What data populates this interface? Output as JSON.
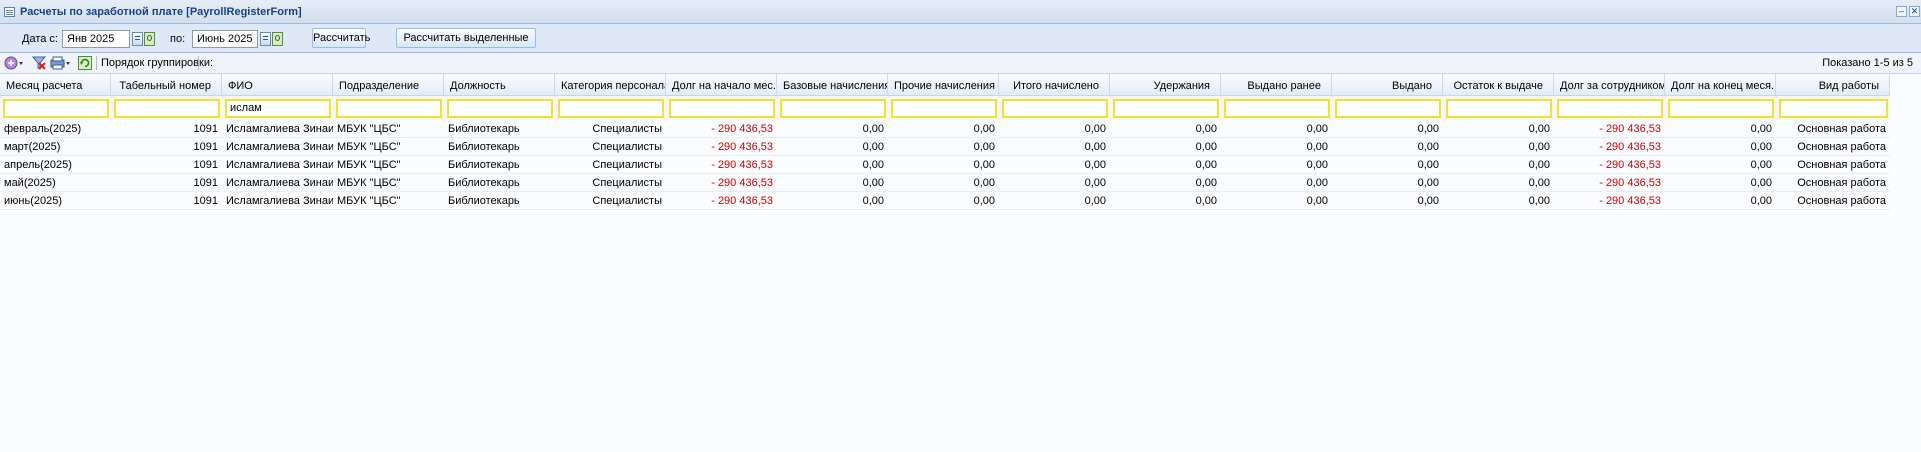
{
  "window": {
    "title": "Расчеты по заработной плате [PayrollRegisterForm]",
    "minimize_glyph": "–",
    "close_glyph": "✕"
  },
  "params": {
    "date_from_label": "Дата с:",
    "date_from_value": "Янв 2025",
    "date_to_label": "по:",
    "date_to_value": "Июнь 2025",
    "calc_button": "Рассчитать",
    "calc_selected_button": "Рассчитать выделенные записи"
  },
  "toolbar": {
    "grouping_label": "Порядок группировки:",
    "shown_text": "Показано 1-5 из 5",
    "icons": [
      "add-menu-icon",
      "clear-filter-icon",
      "print-menu-icon",
      "refresh-icon"
    ]
  },
  "grid": {
    "columns": [
      "Месяц расчета",
      "Табельный номер",
      "ФИО",
      "Подразделение",
      "Должность",
      "Категория персонала",
      "Долг на начало мес...",
      "Базовые начисления",
      "Прочие начисления",
      "Итого начислено",
      "Удержания",
      "Выдано ранее",
      "Выдано",
      "Остаток к выдаче",
      "Долг за сотрудником",
      "Долг на конец меся...",
      "Вид работы"
    ],
    "filters": [
      "",
      "",
      "ислам",
      "",
      "",
      "",
      "",
      "",
      "",
      "",
      "",
      "",
      "",
      "",
      "",
      "",
      ""
    ],
    "rows": [
      [
        "февраль(2025)",
        "1091",
        "Исламгалиева Зинаид...",
        "МБУК \"ЦБС\"",
        "Библиотекарь",
        "Специалисты",
        "- 290 436,53",
        "0,00",
        "0,00",
        "0,00",
        "0,00",
        "0,00",
        "0,00",
        "0,00",
        "- 290 436,53",
        "0,00",
        "Основная работа"
      ],
      [
        "март(2025)",
        "1091",
        "Исламгалиева Зинаид...",
        "МБУК \"ЦБС\"",
        "Библиотекарь",
        "Специалисты",
        "- 290 436,53",
        "0,00",
        "0,00",
        "0,00",
        "0,00",
        "0,00",
        "0,00",
        "0,00",
        "- 290 436,53",
        "0,00",
        "Основная работа"
      ],
      [
        "апрель(2025)",
        "1091",
        "Исламгалиева Зинаид...",
        "МБУК \"ЦБС\"",
        "Библиотекарь",
        "Специалисты",
        "- 290 436,53",
        "0,00",
        "0,00",
        "0,00",
        "0,00",
        "0,00",
        "0,00",
        "0,00",
        "- 290 436,53",
        "0,00",
        "Основная работа"
      ],
      [
        "май(2025)",
        "1091",
        "Исламгалиева Зинаид...",
        "МБУК \"ЦБС\"",
        "Библиотекарь",
        "Специалисты",
        "- 290 436,53",
        "0,00",
        "0,00",
        "0,00",
        "0,00",
        "0,00",
        "0,00",
        "0,00",
        "- 290 436,53",
        "0,00",
        "Основная работа"
      ],
      [
        "июнь(2025)",
        "1091",
        "Исламгалиева Зинаид...",
        "МБУК \"ЦБС\"",
        "Библиотекарь",
        "Специалисты",
        "- 290 436,53",
        "0,00",
        "0,00",
        "0,00",
        "0,00",
        "0,00",
        "0,00",
        "0,00",
        "- 290 436,53",
        "0,00",
        "Основная работа"
      ]
    ]
  },
  "colors": {
    "negative": "#cc0000",
    "filter_border": "#f1e22c",
    "title_text": "#15428b"
  }
}
